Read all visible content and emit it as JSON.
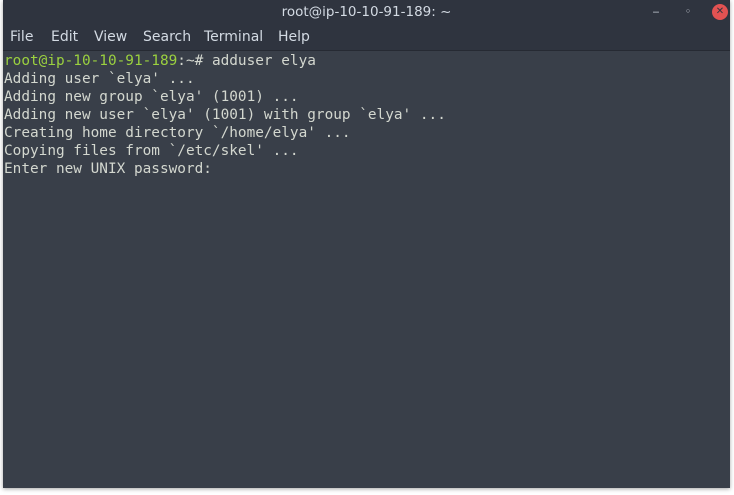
{
  "window": {
    "title": "root@ip-10-10-91-189: ~",
    "controls": {
      "minimize_glyph": "‒",
      "maximize_glyph": "◦",
      "close_glyph": "✕"
    }
  },
  "menu": {
    "file": "File",
    "edit": "Edit",
    "view": "View",
    "search": "Search",
    "terminal": "Terminal",
    "help": "Help"
  },
  "terminal": {
    "prompt_user": "root@ip-10-10-91-189",
    "prompt_path": ":~# ",
    "command": "adduser elya",
    "output": [
      "Adding user `elya' ...",
      "Adding new group `elya' (1001) ...",
      "Adding new user `elya' (1001) with group `elya' ...",
      "Creating home directory `/home/elya' ...",
      "Copying files from `/etc/skel' ...",
      "Enter new UNIX password: "
    ],
    "colors": {
      "background": "#393f49",
      "text": "#d3d7cf",
      "prompt": "#9bd13f"
    }
  }
}
